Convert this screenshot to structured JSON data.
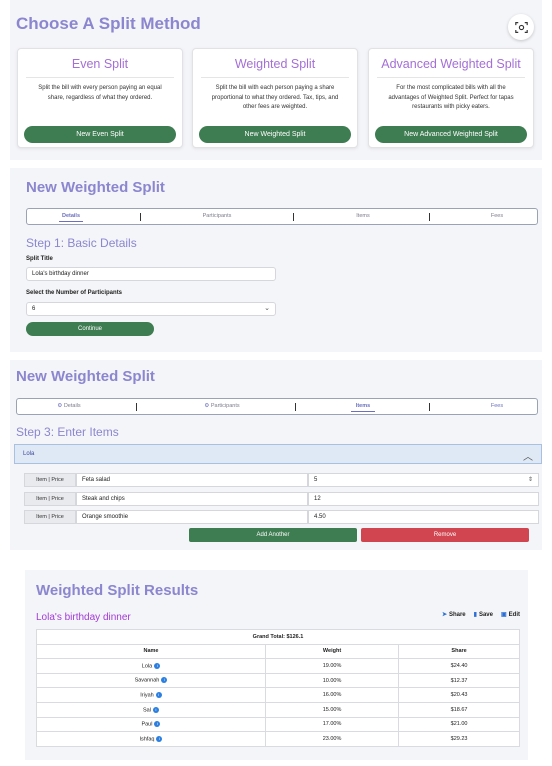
{
  "method": {
    "title": "Choose A Split Method",
    "cards": [
      {
        "title": "Even Split",
        "desc": "Split the bill with every person paying an equal share, regardless of what they ordered.",
        "button": "New Even Split"
      },
      {
        "title": "Weighted Split",
        "desc": "Split the bill with each person paying a share proportional to what they ordered. Tax, tips, and other fees are weighted.",
        "button": "New Weighted Split"
      },
      {
        "title": "Advanced Weighted Split",
        "desc": "For the most complicated bills with all the advantages of Weighted Split. Perfect for tapas restaurants with picky eaters.",
        "button": "New Advanced Weighted Split"
      }
    ]
  },
  "step1": {
    "heading": "New Weighted Split",
    "tabs": [
      "Details",
      "Participants",
      "Items",
      "Fees"
    ],
    "step_title": "Step 1: Basic Details",
    "split_title_label": "Split Title",
    "split_title_value": "Lola's birthday dinner",
    "participants_label": "Select the Number of Participants",
    "participants_value": "6",
    "continue": "Continue"
  },
  "step3": {
    "heading": "New Weighted Split",
    "tabs": [
      "Details",
      "Participants",
      "Items",
      "Fees"
    ],
    "step_title": "Step 3: Enter Items",
    "person": "Lola",
    "prefix": "Item | Price",
    "items": [
      {
        "name": "Feta salad",
        "price": "5"
      },
      {
        "name": "Steak and chips",
        "price": "12"
      },
      {
        "name": "Orange smoothie",
        "price": "4.50"
      }
    ],
    "add": "Add Another",
    "remove": "Remove"
  },
  "results": {
    "heading": "Weighted Split Results",
    "split_name": "Lola's birthday dinner",
    "actions": [
      "Share",
      "Save",
      "Edit"
    ],
    "grand_total": "Grand Total: $126.1",
    "columns": [
      "Name",
      "Weight",
      "Share"
    ],
    "rows": [
      {
        "name": "Lola",
        "weight": "19.00%",
        "share": "$24.40"
      },
      {
        "name": "Savannah",
        "weight": "10.00%",
        "share": "$12.37"
      },
      {
        "name": "Iriyah",
        "weight": "16.00%",
        "share": "$20.43"
      },
      {
        "name": "Sal",
        "weight": "15.00%",
        "share": "$18.67"
      },
      {
        "name": "Paul",
        "weight": "17.00%",
        "share": "$21.00"
      },
      {
        "name": "Ishfaq",
        "weight": "23.00%",
        "share": "$29.23"
      }
    ]
  }
}
